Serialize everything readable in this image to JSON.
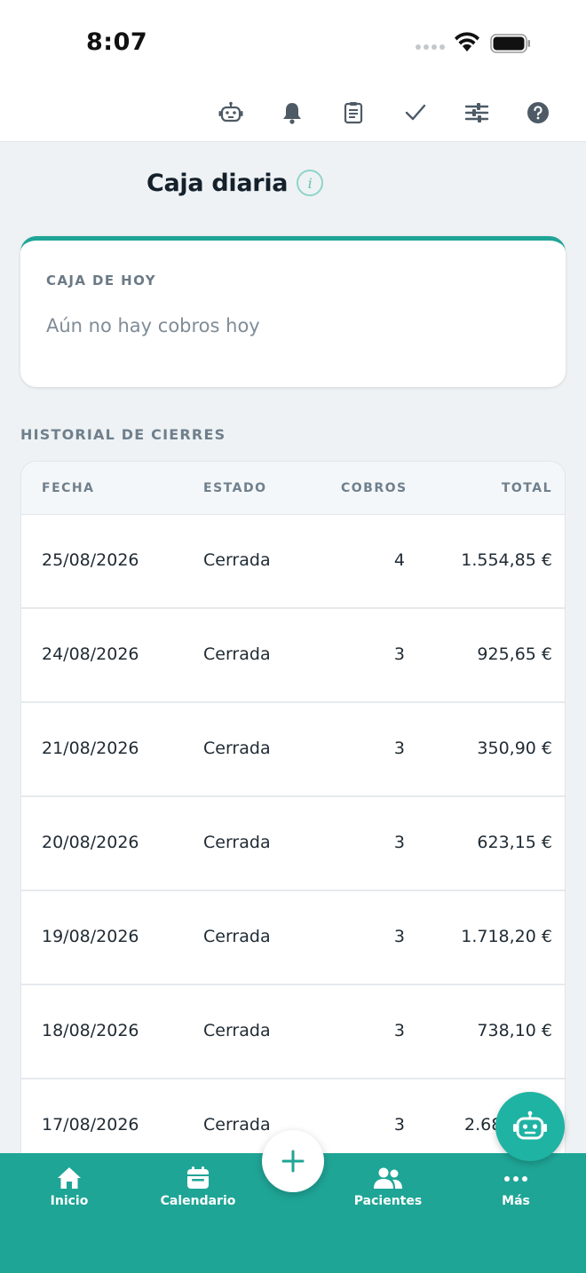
{
  "status_bar": {
    "time": "8:07"
  },
  "toolbar": {
    "icons": [
      "robot-icon",
      "bell-icon",
      "clipboard-icon",
      "check-icon",
      "sliders-icon",
      "help-icon"
    ]
  },
  "page": {
    "title": "Caja diaria",
    "info_glyph": "i"
  },
  "today": {
    "label": "CAJA DE HOY",
    "empty_message": "Aún no hay cobros hoy"
  },
  "history": {
    "title": "HISTORIAL DE CIERRES",
    "columns": {
      "date": "FECHA",
      "status": "ESTADO",
      "count": "COBROS",
      "total": "TOTAL"
    },
    "rows": [
      {
        "date": "25/08/2026",
        "status": "Cerrada",
        "count": "4",
        "total": "1.554,85 €"
      },
      {
        "date": "24/08/2026",
        "status": "Cerrada",
        "count": "3",
        "total": "925,65 €"
      },
      {
        "date": "21/08/2026",
        "status": "Cerrada",
        "count": "3",
        "total": "350,90 €"
      },
      {
        "date": "20/08/2026",
        "status": "Cerrada",
        "count": "3",
        "total": "623,15 €"
      },
      {
        "date": "19/08/2026",
        "status": "Cerrada",
        "count": "3",
        "total": "1.718,20 €"
      },
      {
        "date": "18/08/2026",
        "status": "Cerrada",
        "count": "3",
        "total": "738,10 €"
      },
      {
        "date": "17/08/2026",
        "status": "Cerrada",
        "count": "3",
        "total": "2.68"
      }
    ]
  },
  "bottom_nav": {
    "items": [
      {
        "label": "Inicio",
        "icon": "home-icon"
      },
      {
        "label": "Calendario",
        "icon": "calendar-icon"
      },
      {
        "label": "Pacientes",
        "icon": "users-icon"
      },
      {
        "label": "Más",
        "icon": "more-icon"
      }
    ],
    "add_symbol": "+"
  },
  "colors": {
    "accent": "#1fa596",
    "fab": "#1fb3a3",
    "background": "#eef2f4"
  }
}
